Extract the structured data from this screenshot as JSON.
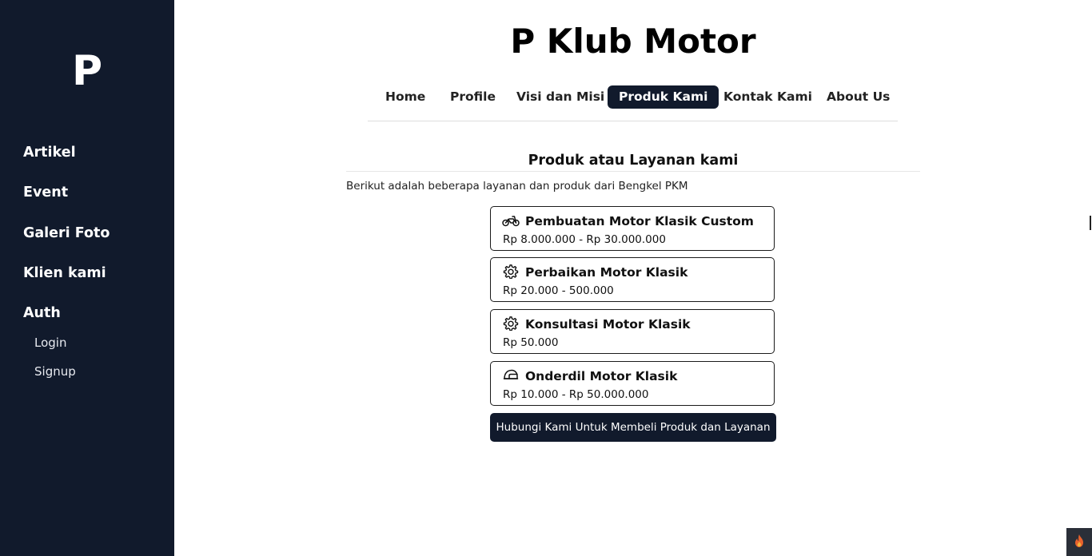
{
  "sidebar": {
    "logo": "P",
    "items": [
      {
        "label": "Artikel"
      },
      {
        "label": "Event"
      },
      {
        "label": "Galeri Foto"
      },
      {
        "label": "Klien kami"
      },
      {
        "label": "Auth"
      }
    ],
    "auth_items": [
      {
        "label": "Login"
      },
      {
        "label": "Signup"
      }
    ]
  },
  "header": {
    "title": "P Klub Motor",
    "nav": [
      {
        "label": "Home"
      },
      {
        "label": "Profile"
      },
      {
        "label": "Visi dan Misi"
      },
      {
        "label": "Produk Kami",
        "active": true
      },
      {
        "label": "Kontak Kami"
      },
      {
        "label": "About Us"
      }
    ]
  },
  "content": {
    "title": "Produk atau Layanan kami",
    "description": "Berikut adalah beberapa layanan dan produk dari Bengkel PKM",
    "products": [
      {
        "icon": "motorcycle-icon",
        "name": "Pembuatan Motor Klasik Custom",
        "price": "Rp 8.000.000 - Rp 30.000.000"
      },
      {
        "icon": "gear-icon",
        "name": "Perbaikan Motor Klasik",
        "price": "Rp 20.000 - 500.000"
      },
      {
        "icon": "gear-icon",
        "name": "Konsultasi Motor Klasik",
        "price": "Rp 50.000"
      },
      {
        "icon": "helmet-icon",
        "name": "Onderdil Motor Klasik",
        "price": "Rp 10.000 - Rp 50.000.000"
      }
    ],
    "cta_label": "Hubungi Kami Untuk Membeli Produk dan Layanan"
  },
  "colors": {
    "sidebar_bg": "#111a2c",
    "accent": "#111a2c",
    "fire_icon": "#e8622c"
  }
}
